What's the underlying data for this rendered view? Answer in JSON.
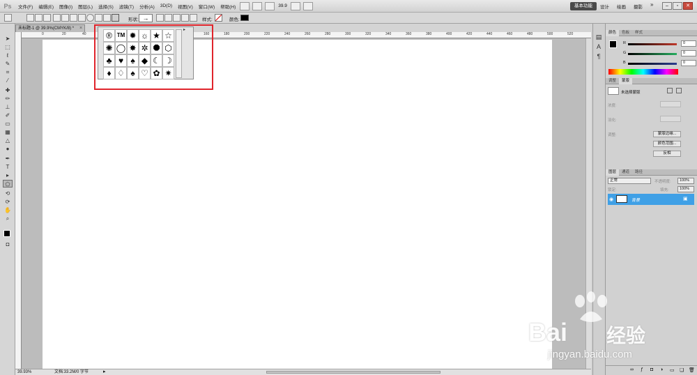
{
  "app": {
    "logo": "Ps"
  },
  "menubar": {
    "items": [
      "文件(F)",
      "编辑(E)",
      "图像(I)",
      "图层(L)",
      "选择(S)",
      "滤镜(T)",
      "分析(A)",
      "3D(D)",
      "视图(V)",
      "窗口(W)",
      "帮助(H)"
    ],
    "zoom": "39.9",
    "workspace": "基本功能",
    "workspace_links": [
      "设计",
      "绘画",
      "摄影"
    ],
    "overflow": "»"
  },
  "options": {
    "shape_label": "形状:",
    "style_label": "样式:",
    "color_label": "颜色:",
    "color_hex": "#000000"
  },
  "document": {
    "tab_title": "未标题-1 @ 39.9%(CMYK/8) *",
    "ruler_ticks": [
      "0",
      "20",
      "40",
      "60",
      "80",
      "100",
      "120",
      "140",
      "160",
      "180",
      "200",
      "220",
      "240",
      "260",
      "280",
      "300",
      "320",
      "340",
      "360",
      "380",
      "400",
      "420",
      "440",
      "460",
      "480",
      "500",
      "520"
    ],
    "status_zoom": "39.93%",
    "status_doc": "文档:33.2M/0 字节"
  },
  "shape_picker": {
    "shapes": [
      {
        "name": "registered",
        "glyph": "®",
        "small": false
      },
      {
        "name": "trademark",
        "glyph": "TM",
        "small": true
      },
      {
        "name": "burst",
        "glyph": "✹",
        "small": false
      },
      {
        "name": "sun",
        "glyph": "☼",
        "small": false
      },
      {
        "name": "star",
        "glyph": "★",
        "small": false
      },
      {
        "name": "star-outline",
        "glyph": "☆",
        "small": false
      },
      {
        "name": "seal",
        "glyph": "✺",
        "small": false
      },
      {
        "name": "circle",
        "glyph": "◯",
        "small": false
      },
      {
        "name": "burst-2",
        "glyph": "✸",
        "small": false
      },
      {
        "name": "gear-ring",
        "glyph": "✲",
        "small": false
      },
      {
        "name": "octagon",
        "glyph": "⯃",
        "small": false
      },
      {
        "name": "hexagon-outline",
        "glyph": "⬡",
        "small": false
      },
      {
        "name": "club",
        "glyph": "♣",
        "small": false
      },
      {
        "name": "heart",
        "glyph": "♥",
        "small": false
      },
      {
        "name": "spade",
        "glyph": "♠",
        "small": false
      },
      {
        "name": "diamond",
        "glyph": "◆",
        "small": false
      },
      {
        "name": "crescent",
        "glyph": "☾",
        "small": false
      },
      {
        "name": "crescent-outline",
        "glyph": "☽",
        "small": false
      },
      {
        "name": "diamond-2",
        "glyph": "♦",
        "small": false
      },
      {
        "name": "diamond-outline",
        "glyph": "♢",
        "small": false
      },
      {
        "name": "spade-2",
        "glyph": "♠",
        "small": false
      },
      {
        "name": "heart-outline",
        "glyph": "♡",
        "small": false
      },
      {
        "name": "flower",
        "glyph": "✿",
        "small": false
      },
      {
        "name": "sunburst-outline",
        "glyph": "✷",
        "small": false
      }
    ]
  },
  "color_panel": {
    "tabs": [
      "颜色",
      "色板",
      "样式"
    ],
    "channels": [
      {
        "label": "R",
        "value": "0",
        "color": "#c0392b"
      },
      {
        "label": "G",
        "value": "0",
        "color": "#27ae60"
      },
      {
        "label": "B",
        "value": "0",
        "color": "#2c3e90"
      }
    ]
  },
  "adjust_panel": {
    "tabs": [
      "调整",
      "蒙版"
    ],
    "mask_label": "未选择蒙版",
    "density_label": "浓度:",
    "feather_label": "羽化:",
    "refine_label": "调整:",
    "buttons": [
      "蒙版边缘...",
      "颜色范围...",
      "反相"
    ]
  },
  "layers_panel": {
    "tabs": [
      "图层",
      "通道",
      "路径"
    ],
    "blend_mode": "正常",
    "opacity_label": "不透明度:",
    "opacity": "100%",
    "lock_label": "锁定:",
    "fill_label": "填充:",
    "fill": "100%",
    "layer_name": "背景"
  },
  "watermark": {
    "brand": "Bai",
    "brand_cn": "经验",
    "url": "jingyan.baidu.com"
  }
}
